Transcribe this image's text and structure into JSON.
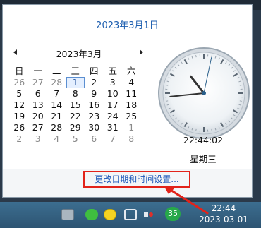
{
  "popup": {
    "header_date": "2023年3月1日",
    "calendar": {
      "month_title": "2023年3月",
      "weekdays": [
        "日",
        "一",
        "二",
        "三",
        "四",
        "五",
        "六"
      ],
      "weeks": [
        [
          "26",
          "27",
          "28",
          "1",
          "2",
          "3",
          "4"
        ],
        [
          "5",
          "6",
          "7",
          "8",
          "9",
          "10",
          "11"
        ],
        [
          "12",
          "13",
          "14",
          "15",
          "16",
          "17",
          "18"
        ],
        [
          "19",
          "20",
          "21",
          "22",
          "23",
          "24",
          "25"
        ],
        [
          "26",
          "27",
          "28",
          "29",
          "30",
          "31",
          "1"
        ],
        [
          "2",
          "3",
          "4",
          "5",
          "6",
          "7",
          "8"
        ]
      ],
      "selected_day": "1"
    },
    "clock": {
      "time": "22:44:02",
      "weekday": "星期三",
      "hour": 22,
      "minute": 44,
      "second": 2
    },
    "settings_link": "更改日期和时间设置..."
  },
  "taskbar": {
    "badge_count": "35",
    "time": "22:44",
    "date": "2023-03-01"
  },
  "colors": {
    "link": "#1b56b8",
    "highlight_box": "#e2231a",
    "taskbar": "#2d5472"
  }
}
